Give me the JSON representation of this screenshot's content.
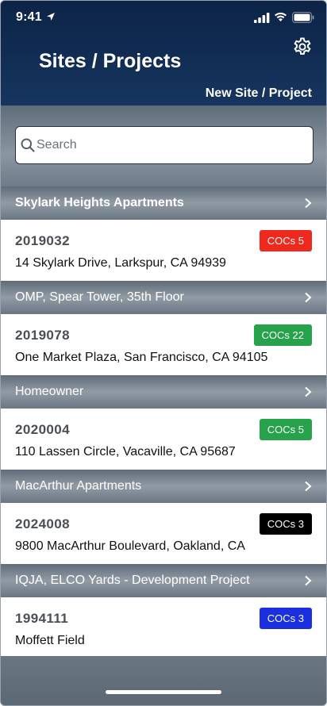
{
  "status_bar": {
    "time": "9:41"
  },
  "header": {
    "title": "Sites / Projects",
    "new_site_label": "New Site / Project",
    "settings_icon": "gear-icon"
  },
  "search": {
    "placeholder": "Search",
    "value": ""
  },
  "sections": [
    {
      "title": "Skylark Heights Apartments",
      "project_number": "2019032",
      "address": "14 Skylark Drive, Larkspur, CA 94939",
      "badge": "COCs 5",
      "badge_color": "#f0291f"
    },
    {
      "title": "OMP, Spear Tower, 35th Floor",
      "project_number": "2019078",
      "address": "One Market Plaza, San Francisco, CA 94105",
      "badge": "COCs 22",
      "badge_color": "#25a24a"
    },
    {
      "title": "Homeowner",
      "project_number": "2020004",
      "address": "110 Lassen Circle, Vacaville, CA 95687",
      "badge": "COCs 5",
      "badge_color": "#25a24a"
    },
    {
      "title": "MacArthur Apartments",
      "project_number": "2024008",
      "address": "9800 MacArthur Boulevard, Oakland, CA",
      "badge": "COCs 3",
      "badge_color": "#000000"
    },
    {
      "title": "IQJA, ELCO Yards - Development Project",
      "project_number": "1994111",
      "address": "Moffett Field",
      "badge": "COCs 3",
      "badge_color": "#1a2fe0"
    }
  ]
}
